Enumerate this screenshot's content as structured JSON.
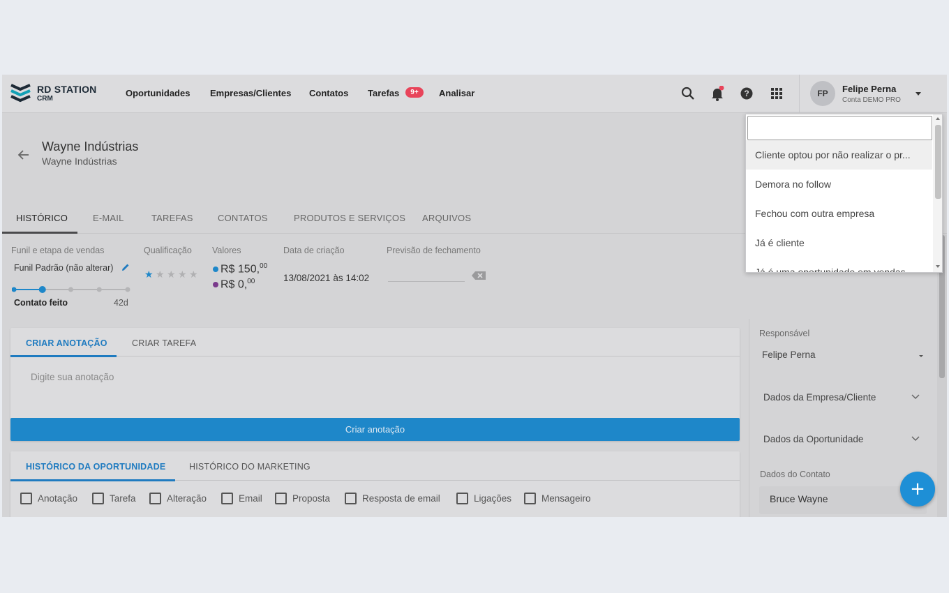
{
  "brand": {
    "name": "RD STATION",
    "product": "CRM"
  },
  "nav": {
    "items": [
      "Oportunidades",
      "Empresas/Clientes",
      "Contatos",
      "Tarefas",
      "Analisar"
    ],
    "tasks_badge": "9+"
  },
  "topbar_icons": [
    "search-icon",
    "bell-icon",
    "help-icon",
    "apps-grid-icon"
  ],
  "user": {
    "initials": "FP",
    "name": "Felipe Perna",
    "account": "Conta DEMO PRO"
  },
  "header": {
    "title": "Wayne Indústrias",
    "subtitle": "Wayne Indústrias"
  },
  "tabs": [
    "HISTÓRICO",
    "E-MAIL",
    "TAREFAS",
    "CONTATOS",
    "PRODUTOS E SERVIÇOS",
    "ARQUIVOS"
  ],
  "info": {
    "funnel_label": "Funil e etapa de vendas",
    "funnel_value": "Funil Padrão (não alterar)",
    "stage_name": "Contato feito",
    "stage_days": "42d",
    "stage_count": 5,
    "stage_current": 2,
    "rating_label": "Qualificação",
    "rating": 1,
    "rating_max": 5,
    "values_label": "Valores",
    "value_one_main": "R$ 150,",
    "value_one_cents": "00",
    "value_recurring_main": "R$ 0,",
    "value_recurring_cents": "00",
    "created_label": "Data de criação",
    "created_value": "13/08/2021 às 14:02",
    "forecast_label": "Previsão de fechamento"
  },
  "note_card": {
    "tabs": [
      "CRIAR ANOTAÇÃO",
      "CRIAR TAREFA"
    ],
    "placeholder": "Digite sua anotação",
    "button": "Criar anotação"
  },
  "history_card": {
    "tabs": [
      "HISTÓRICO DA OPORTUNIDADE",
      "HISTÓRICO DO MARKETING"
    ],
    "filters": [
      "Anotação",
      "Tarefa",
      "Alteração",
      "Email",
      "Proposta",
      "Resposta de email",
      "Ligações",
      "Mensageiro"
    ]
  },
  "right_panel": {
    "responsible_label": "Responsável",
    "responsible_value": "Felipe Perna",
    "company_data": "Dados da Empresa/Cliente",
    "opportunity_data": "Dados da Oportunidade",
    "contact_data": "Dados do Contato",
    "contact_name": "Bruce Wayne"
  },
  "dropdown": {
    "search_value": "",
    "options": [
      "Cliente optou por não realizar o pr...",
      "Demora no follow",
      "Fechou com outra empresa",
      "Já é cliente",
      "Já é uma oportunidade em vendas"
    ]
  }
}
